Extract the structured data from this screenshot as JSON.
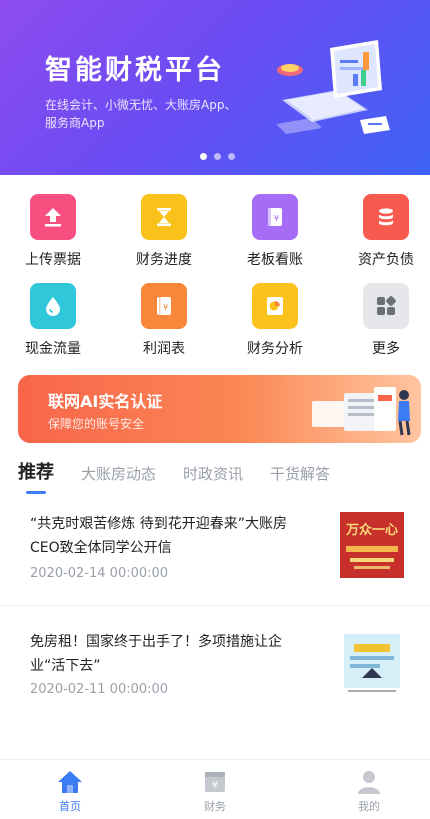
{
  "banner": {
    "title": "智能财税平台",
    "subtitle": "在线会计、小微无忧、大账房App、服务商App",
    "slides": 3,
    "active_slide": 1
  },
  "grid": [
    {
      "label": "上传票据",
      "icon": "upload-icon",
      "color": "#f74f7f"
    },
    {
      "label": "财务进度",
      "icon": "hourglass-icon",
      "color": "#f8c21a"
    },
    {
      "label": "老板看账",
      "icon": "ledger-icon",
      "color": "#a66cf6"
    },
    {
      "label": "资产负债",
      "icon": "database-icon",
      "color": "#f75a4e"
    },
    {
      "label": "现金流量",
      "icon": "water-drop-icon",
      "color": "#2fc7d9"
    },
    {
      "label": "利润表",
      "icon": "notebook-icon",
      "color": "#f8873c"
    },
    {
      "label": "财务分析",
      "icon": "pie-chart-icon",
      "color": "#fbc21c"
    },
    {
      "label": "更多",
      "icon": "more-grid-icon",
      "color": "#e6e7ea"
    }
  ],
  "promo": {
    "title": "联网AI实名认证",
    "subtitle": "保障您的账号安全"
  },
  "tabs": [
    {
      "label": "推荐",
      "active": true
    },
    {
      "label": "大账房动态",
      "active": false
    },
    {
      "label": "时政资讯",
      "active": false
    },
    {
      "label": "干货解答",
      "active": false
    }
  ],
  "news": [
    {
      "headline": "“共克时艰苦修炼 待到花开迎春来”大账房CEO致全体同学公开信",
      "date": "2020-02-14 00:00:00",
      "thumb_text": "万众一心"
    },
    {
      "headline": "免房租！国家终于出手了！多项措施让企业“活下去”",
      "date": "2020-02-11 00:00:00",
      "thumb_text": ""
    }
  ],
  "bottom_nav": [
    {
      "label": "首页",
      "icon": "home-icon",
      "active": true
    },
    {
      "label": "财务",
      "icon": "finance-icon",
      "active": false
    },
    {
      "label": "我的",
      "icon": "profile-icon",
      "active": false
    }
  ],
  "colors": {
    "accent": "#3b7cf4",
    "muted": "#9aa0aa"
  }
}
